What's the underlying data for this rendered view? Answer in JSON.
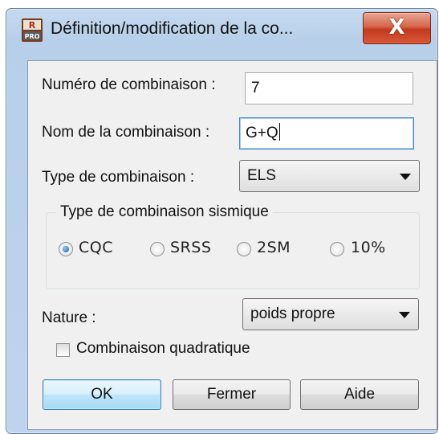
{
  "window": {
    "title": "Définition/modification de la co...",
    "close_label": "X",
    "app_icon": "robot-pro-icon",
    "accent": "#c2391e"
  },
  "form": {
    "numero_label": "Numéro de combinaison :",
    "numero_value": "7",
    "nom_label": "Nom de la combinaison :",
    "nom_value": "G+Q",
    "type_label": "Type de combinaison :",
    "type_value": "ELS",
    "sismique": {
      "title": "Type de combinaison sismique",
      "options": [
        "CQC",
        "SRSS",
        "2SM",
        "10%"
      ],
      "selected": "CQC"
    },
    "nature_label": "Nature :",
    "nature_value": "poids propre",
    "quadratique_label": "Combinaison quadratique",
    "quadratique_checked": false
  },
  "buttons": {
    "ok": "OK",
    "fermer": "Fermer",
    "aide": "Aide"
  }
}
